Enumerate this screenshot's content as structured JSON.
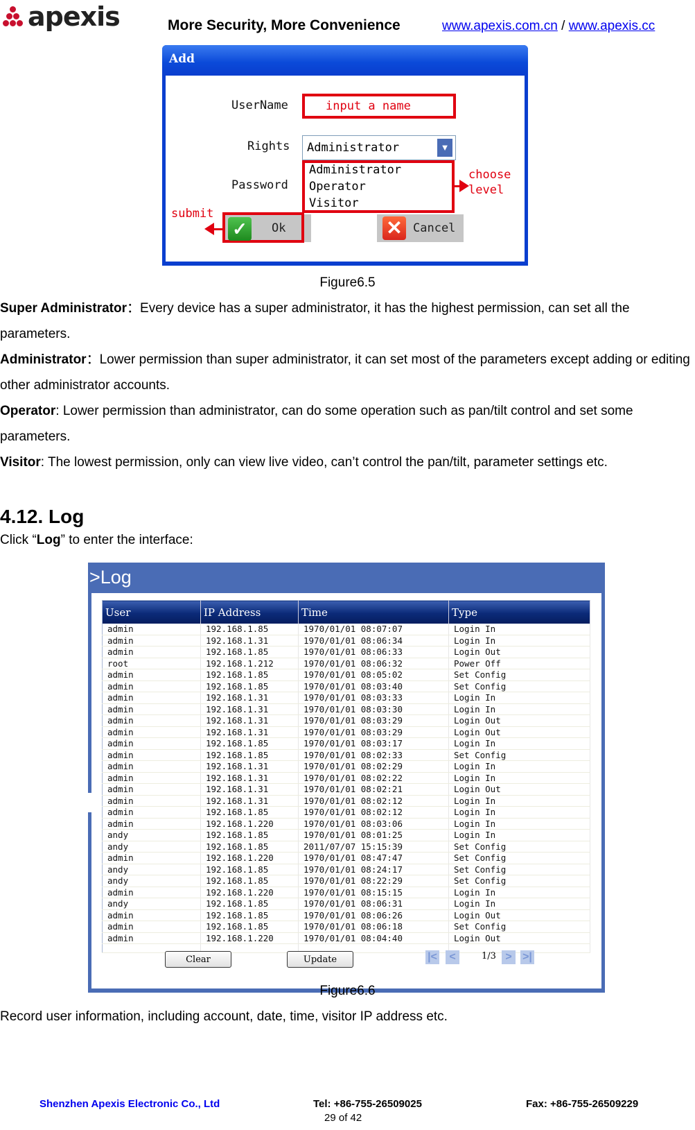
{
  "header": {
    "logo_text": "apexis",
    "tagline": "More Security, More Convenience",
    "link1": "www.apexis.com.cn",
    "separator": " / ",
    "link2": "www.apexis.cc"
  },
  "figure65": {
    "dialog_title": "Add",
    "username_label": "UserName",
    "username_placeholder": "input a name",
    "rights_label": "Rights",
    "rights_selected": "Administrator",
    "dropdown_icon": "▼",
    "password_label": "Password",
    "rights_options": [
      "Administrator",
      "Operator",
      "Visitor"
    ],
    "annotation_choose": "choose",
    "annotation_level": "level",
    "annotation_submit": "submit",
    "ok_label": "Ok",
    "cancel_label": "Cancel",
    "caption": "Figure6.5"
  },
  "roles": [
    {
      "name": "Super Administrator",
      "sep": "：",
      "text": "Every device has a super administrator, it has the highest permission, can set all the parameters."
    },
    {
      "name": "Administrator",
      "sep": "：",
      "text": "Lower permission than super administrator, it can set most of the parameters except adding or editing other administrator accounts."
    },
    {
      "name": "Operator",
      "sep": ": ",
      "text": "Lower permission than administrator, can do some operation such as pan/tilt control and set some parameters."
    },
    {
      "name": "Visitor",
      "sep": ": ",
      "text": "The lowest permission, only can view live video, can’t control the pan/tilt, parameter settings etc."
    }
  ],
  "section": {
    "heading": "4.12. Log",
    "intro_pre": "Click “",
    "intro_bold": "Log",
    "intro_post": "” to enter the interface:"
  },
  "log_panel": {
    "title": ">Log",
    "columns": [
      "User",
      "IP Address",
      "Time",
      "Type"
    ],
    "rows": [
      [
        "admin",
        "192.168.1.85",
        "1970/01/01 08:07:07",
        "Login In"
      ],
      [
        "admin",
        "192.168.1.31",
        "1970/01/01 08:06:34",
        "Login In"
      ],
      [
        "admin",
        "192.168.1.85",
        "1970/01/01 08:06:33",
        "Login Out"
      ],
      [
        "root",
        "192.168.1.212",
        "1970/01/01 08:06:32",
        "Power Off"
      ],
      [
        "admin",
        "192.168.1.85",
        "1970/01/01 08:05:02",
        "Set Config"
      ],
      [
        "admin",
        "192.168.1.85",
        "1970/01/01 08:03:40",
        "Set Config"
      ],
      [
        "admin",
        "192.168.1.31",
        "1970/01/01 08:03:33",
        "Login In"
      ],
      [
        "admin",
        "192.168.1.31",
        "1970/01/01 08:03:30",
        "Login In"
      ],
      [
        "admin",
        "192.168.1.31",
        "1970/01/01 08:03:29",
        "Login Out"
      ],
      [
        "admin",
        "192.168.1.31",
        "1970/01/01 08:03:29",
        "Login Out"
      ],
      [
        "admin",
        "192.168.1.85",
        "1970/01/01 08:03:17",
        "Login In"
      ],
      [
        "admin",
        "192.168.1.85",
        "1970/01/01 08:02:33",
        "Set Config"
      ],
      [
        "admin",
        "192.168.1.31",
        "1970/01/01 08:02:29",
        "Login In"
      ],
      [
        "admin",
        "192.168.1.31",
        "1970/01/01 08:02:22",
        "Login In"
      ],
      [
        "admin",
        "192.168.1.31",
        "1970/01/01 08:02:21",
        "Login Out"
      ],
      [
        "admin",
        "192.168.1.31",
        "1970/01/01 08:02:12",
        "Login In"
      ],
      [
        "admin",
        "192.168.1.85",
        "1970/01/01 08:02:12",
        "Login In"
      ],
      [
        "admin",
        "192.168.1.220",
        "1970/01/01 08:03:06",
        "Login In"
      ],
      [
        "andy",
        "192.168.1.85",
        "1970/01/01 08:01:25",
        "Login In"
      ],
      [
        "andy",
        "192.168.1.85",
        "2011/07/07 15:15:39",
        "Set Config"
      ],
      [
        "admin",
        "192.168.1.220",
        "1970/01/01 08:47:47",
        "Set Config"
      ],
      [
        "andy",
        "192.168.1.85",
        "1970/01/01 08:24:17",
        "Set Config"
      ],
      [
        "andy",
        "192.168.1.85",
        "1970/01/01 08:22:29",
        "Set Config"
      ],
      [
        "admin",
        "192.168.1.220",
        "1970/01/01 08:15:15",
        "Login In"
      ],
      [
        "andy",
        "192.168.1.85",
        "1970/01/01 08:06:31",
        "Login In"
      ],
      [
        "admin",
        "192.168.1.85",
        "1970/01/01 08:06:26",
        "Login Out"
      ],
      [
        "admin",
        "192.168.1.85",
        "1970/01/01 08:06:18",
        "Set Config"
      ],
      [
        "admin",
        "192.168.1.220",
        "1970/01/01 08:04:40",
        "Login Out"
      ]
    ],
    "clear_label": "Clear",
    "update_label": "Update",
    "pager": {
      "first": "|<",
      "prev": "<",
      "page": "1/3",
      "next": ">",
      "last": ">|"
    }
  },
  "figure66_caption": "Figure6.6",
  "closing_text": "Record user information, including account, date, time, visitor IP address etc.",
  "footer": {
    "company": "Shenzhen Apexis Electronic Co., Ltd",
    "tel": "Tel: +86-755-26509025",
    "fax": "Fax: +86-755-26509229",
    "page": "29 of 42"
  }
}
